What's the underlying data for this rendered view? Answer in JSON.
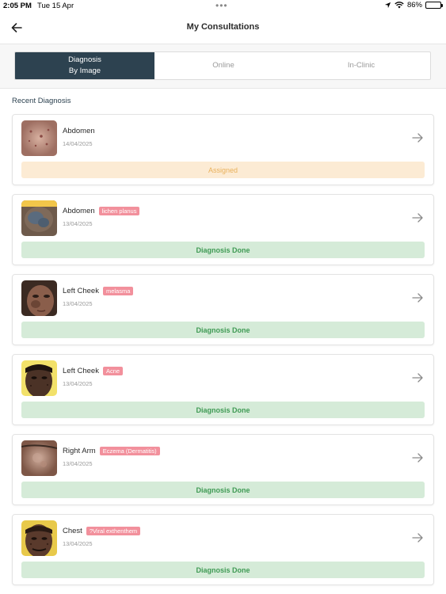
{
  "status_bar": {
    "time": "2:05 PM",
    "date": "Tue 15 Apr",
    "dots": "•••",
    "battery": "86%",
    "battery_level": 0.86
  },
  "header": {
    "title": "My Consultations",
    "back_icon": "arrow-left-icon"
  },
  "tabs": [
    {
      "label": "Diagnosis\nBy Image",
      "active": true
    },
    {
      "label": "Online",
      "active": false
    },
    {
      "label": "In-Clinic",
      "active": false
    }
  ],
  "section_title": "Recent Diagnosis",
  "colors": {
    "primary": "#2d4250",
    "tag": "#f2909c",
    "assigned_bg": "#fcebd4",
    "assigned_text": "#e9b15c",
    "done_bg": "#d5ebd8",
    "done_text": "#3f9a54"
  },
  "diagnoses": [
    {
      "location": "Abdomen",
      "tag": "",
      "date": "14/04/2025",
      "status": "Assigned",
      "status_type": "assigned"
    },
    {
      "location": "Abdomen",
      "tag": "lichen planus",
      "date": "13/04/2025",
      "status": "Diagnosis Done",
      "status_type": "done"
    },
    {
      "location": "Left Cheek",
      "tag": "melasma",
      "date": "13/04/2025",
      "status": "Diagnosis Done",
      "status_type": "done"
    },
    {
      "location": "Left Cheek",
      "tag": "Acne",
      "date": "13/04/2025",
      "status": "Diagnosis Done",
      "status_type": "done"
    },
    {
      "location": "Right Arm",
      "tag": "Eczema (Dermatitis)",
      "date": "13/04/2025",
      "status": "Diagnosis Done",
      "status_type": "done"
    },
    {
      "location": "Chest",
      "tag": "?Viral exthenthem",
      "date": "13/04/2025",
      "status": "Diagnosis Done",
      "status_type": "done"
    }
  ]
}
